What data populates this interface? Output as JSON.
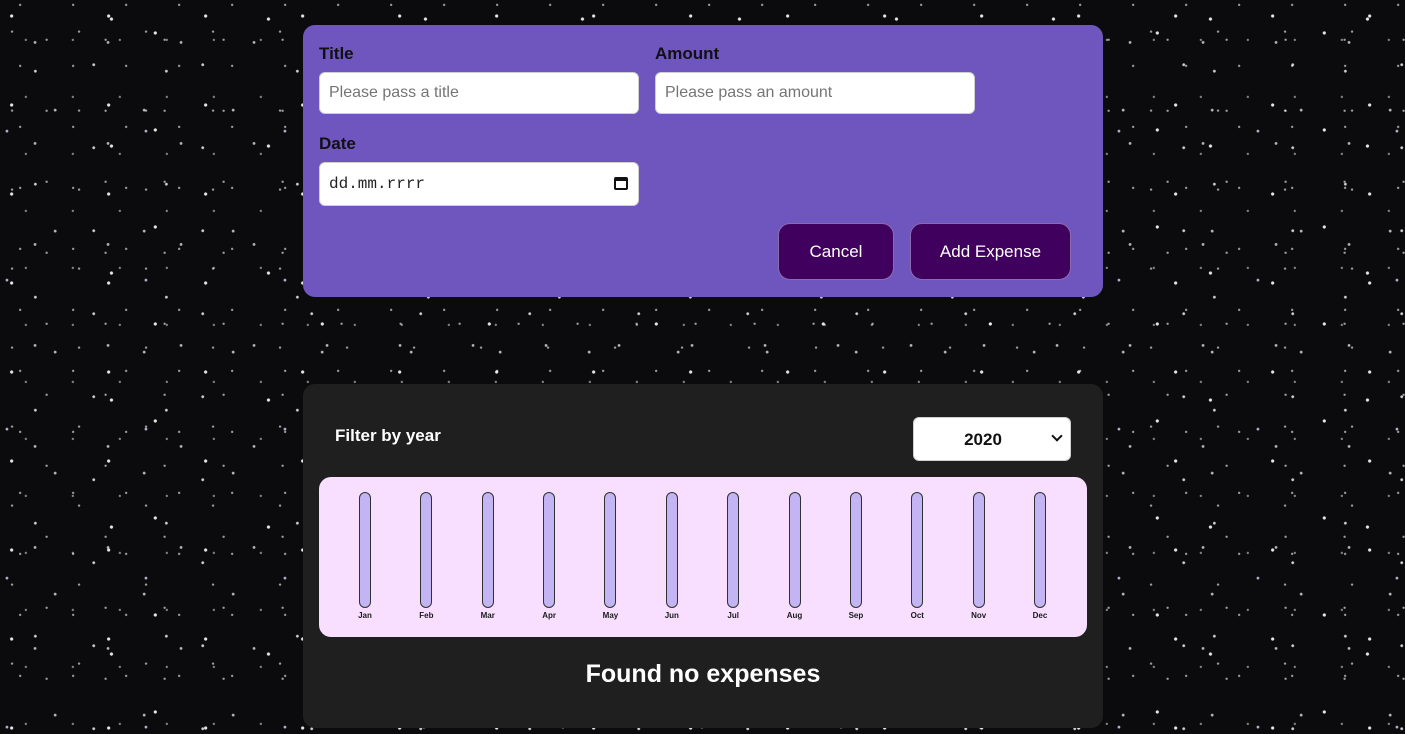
{
  "form": {
    "title_label": "Title",
    "title_placeholder": "Please pass a title",
    "title_value": "",
    "amount_label": "Amount",
    "amount_placeholder": "Please pass an amount",
    "amount_value": "",
    "date_label": "Date",
    "date_display": "dd.mm.rrrr",
    "cancel_label": "Cancel",
    "submit_label": "Add Expense"
  },
  "expenses": {
    "filter_label": "Filter by year",
    "selected_year": "2020",
    "empty_message": "Found no expenses"
  },
  "chart_data": {
    "type": "bar",
    "categories": [
      "Jan",
      "Feb",
      "Mar",
      "Apr",
      "May",
      "Jun",
      "Jul",
      "Aug",
      "Sep",
      "Oct",
      "Nov",
      "Dec"
    ],
    "values": [
      0,
      0,
      0,
      0,
      0,
      0,
      0,
      0,
      0,
      0,
      0,
      0
    ]
  },
  "colors": {
    "form_background": "#6f55be",
    "button_background": "#40005d",
    "panel_background": "#1f1f1f",
    "chart_background": "#f8dfff",
    "bar_empty": "#c3b4f3",
    "bar_fill": "#4826b9"
  },
  "icons": {
    "date_picker": "calendar-icon",
    "year_dropdown": "chevron-down-icon"
  }
}
